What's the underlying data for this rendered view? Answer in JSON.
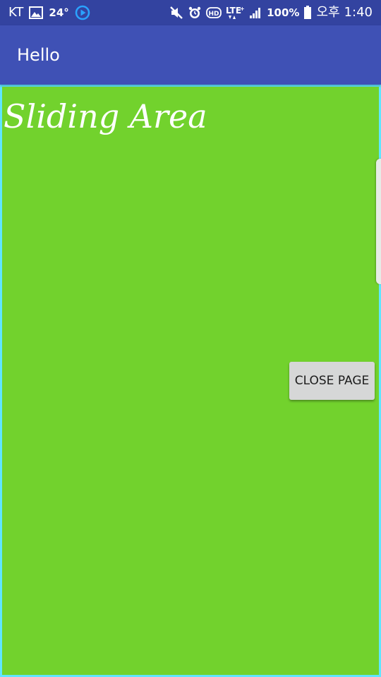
{
  "status_bar": {
    "carrier": "KT",
    "temperature": "24°",
    "network": "LTE",
    "battery": "100%",
    "time_period": "오후",
    "time": "1:40",
    "icons": [
      "image-icon",
      "play-circle-icon",
      "mute-icon",
      "alarm-icon",
      "hd-icon",
      "lte-icon",
      "signal-icon",
      "battery-icon"
    ]
  },
  "app_bar": {
    "title": "Hello"
  },
  "sliding_area": {
    "title": "Sliding Area",
    "close_button_label": "CLOSE PAGE"
  },
  "colors": {
    "status_bar": "#3343a0",
    "app_bar": "#3f51b5",
    "sliding_area": "#72d22d",
    "border": "#5fe6ff",
    "button": "#d6d7d7"
  }
}
